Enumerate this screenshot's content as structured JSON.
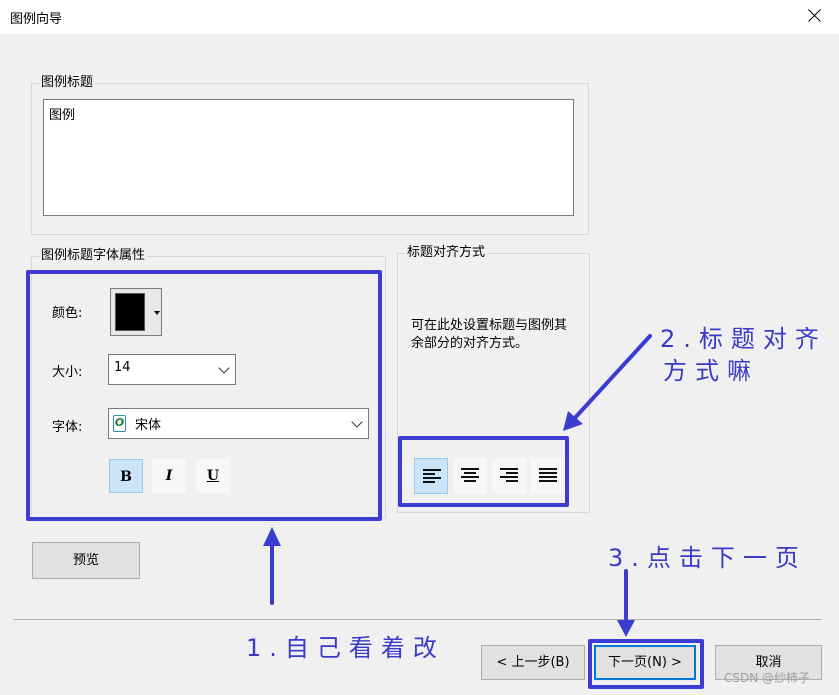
{
  "window": {
    "title": "图例向导"
  },
  "legend_title_group": {
    "label": "图例标题",
    "text_value": "图例"
  },
  "font_props_group": {
    "label": "图例标题字体属性",
    "color_label": "颜色:",
    "color_value": "#000000",
    "size_label": "大小:",
    "size_value": "14",
    "font_label": "字体:",
    "font_value": "宋体",
    "font_icon_glyph": "O",
    "bold_label": "B",
    "italic_label": "I",
    "underline_label": "U"
  },
  "alignment_group": {
    "label": "标题对齐方式",
    "description": "可在此处设置标题与图例其余部分的对齐方式。",
    "options": [
      "align-left",
      "align-center",
      "align-right",
      "justify"
    ],
    "selected": "align-left"
  },
  "buttons": {
    "preview": "预览",
    "back": "< 上一步(B)",
    "next": "下一页(N) >",
    "cancel": "取消"
  },
  "annotations": {
    "note1": "1.自己看着改",
    "note2_line1": "2.标题对齐",
    "note2_line2": "方式嘛",
    "note3": "3.点击下一页"
  },
  "watermark": "CSDN @纱柿子",
  "colors": {
    "highlight": "#3c3cd2",
    "selected_button": "#cce4f7"
  }
}
